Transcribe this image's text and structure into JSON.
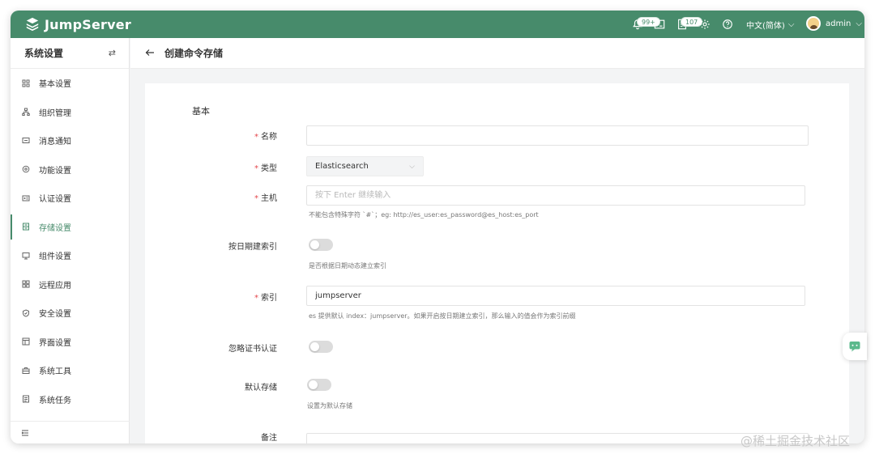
{
  "app": {
    "logo_text": "JumpServer",
    "accent_color": "#478b6b"
  },
  "header": {
    "notifications_badge": "99+",
    "tickets_badge": "107",
    "language": "中文(简体)",
    "username": "admin",
    "icons": [
      "bell-icon",
      "terminal-icon",
      "ticket-icon",
      "settings-icon",
      "help-icon"
    ]
  },
  "sidebar": {
    "title": "系统设置",
    "items": [
      {
        "label": "基本设置",
        "icon": "grid-icon",
        "active": false
      },
      {
        "label": "组织管理",
        "icon": "org-icon",
        "active": false
      },
      {
        "label": "消息通知",
        "icon": "message-icon",
        "active": false
      },
      {
        "label": "功能设置",
        "icon": "feature-icon",
        "active": false
      },
      {
        "label": "认证设置",
        "icon": "auth-icon",
        "active": false
      },
      {
        "label": "存储设置",
        "icon": "storage-icon",
        "active": true
      },
      {
        "label": "组件设置",
        "icon": "component-icon",
        "active": false
      },
      {
        "label": "远程应用",
        "icon": "remote-app-icon",
        "active": false
      },
      {
        "label": "安全设置",
        "icon": "shield-icon",
        "active": false
      },
      {
        "label": "界面设置",
        "icon": "interface-icon",
        "active": false
      },
      {
        "label": "系统工具",
        "icon": "toolbox-icon",
        "active": false
      },
      {
        "label": "系统任务",
        "icon": "task-icon",
        "active": false
      }
    ]
  },
  "page": {
    "title": "创建命令存储"
  },
  "form": {
    "section_title": "基本",
    "name_label": "名称",
    "name_value": "",
    "type_label": "类型",
    "type_value": "Elasticsearch",
    "host_label": "主机",
    "host_placeholder": "按下 Enter 继续输入",
    "host_hint": "不能包含特殊字符 `#`；eg: http://es_user:es_password@es_host:es_port",
    "date_index_label": "按日期建索引",
    "date_index_hint": "是否根据日期动态建立索引",
    "index_label": "索引",
    "index_value": "jumpserver",
    "index_hint": "es 提供默认 index：jumpserver。如果开启按日期建立索引，那么输入的值会作为索引前缀",
    "ignore_cert_label": "忽略证书认证",
    "default_storage_label": "默认存储",
    "default_storage_hint": "设置为默认存储",
    "comment_label": "备注"
  },
  "watermark": "@稀土掘金技术社区"
}
